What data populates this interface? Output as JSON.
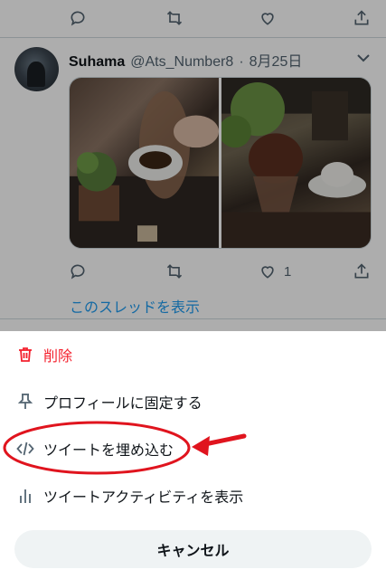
{
  "feed": {
    "prev_actions": {
      "reply": "reply-icon",
      "retweet": "retweet-icon",
      "like": "heart-icon",
      "share": "share-icon"
    },
    "tweet": {
      "name": "Suhama",
      "handle": "@Ats_Number8",
      "separator": "·",
      "date": "8月25日",
      "like_count": "1",
      "show_thread": "このスレッドを表示"
    }
  },
  "sheet": {
    "items": [
      {
        "label": "削除",
        "icon": "trash-icon",
        "color": "#f4212e"
      },
      {
        "label": "プロフィールに固定する",
        "icon": "pin-icon"
      },
      {
        "label": "ツイートを埋め込む",
        "icon": "code-icon"
      },
      {
        "label": "ツイートアクティビティを表示",
        "icon": "bar-chart-icon"
      }
    ],
    "cancel_label": "キャンセル"
  },
  "annotation_color": "#e0141e"
}
